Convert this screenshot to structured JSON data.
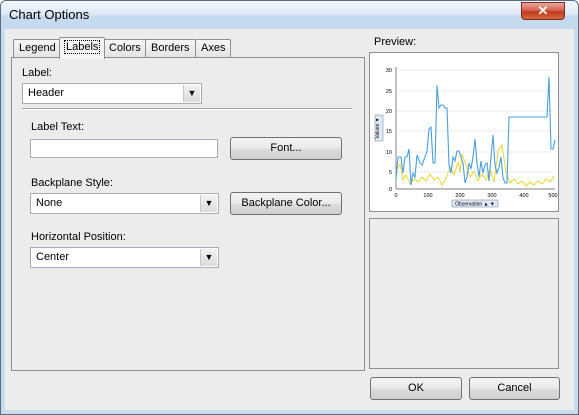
{
  "window": {
    "title": "Chart Options",
    "close_glyph": "✕"
  },
  "tabs": [
    {
      "label": "Legend"
    },
    {
      "label": "Labels",
      "active": true
    },
    {
      "label": "Colors"
    },
    {
      "label": "Borders"
    },
    {
      "label": "Axes"
    }
  ],
  "labels_page": {
    "label_caption": "Label:",
    "label_value": "Header",
    "label_text_caption": "Label Text:",
    "label_text_value": "",
    "font_button": "Font...",
    "backplane_style_caption": "Backplane Style:",
    "backplane_style_value": "None",
    "backplane_color_button": "Backplane Color...",
    "horizontal_position_caption": "Horizontal Position:",
    "horizontal_position_value": "Center"
  },
  "preview": {
    "caption": "Preview:",
    "y_axis_label": "Values ▼",
    "x_axis_label": "Observation ▲ ▼",
    "y_ticks": [
      "30",
      "25",
      "20",
      "15",
      "10",
      "5",
      "0"
    ],
    "x_ticks": [
      "0",
      "100",
      "200",
      "300",
      "400",
      "500"
    ],
    "series_colors": {
      "blue": "#4a9fde",
      "yellow": "#e8d31f"
    }
  },
  "footer": {
    "ok": "OK",
    "cancel": "Cancel"
  },
  "icons": {
    "dropdown": "▼"
  }
}
